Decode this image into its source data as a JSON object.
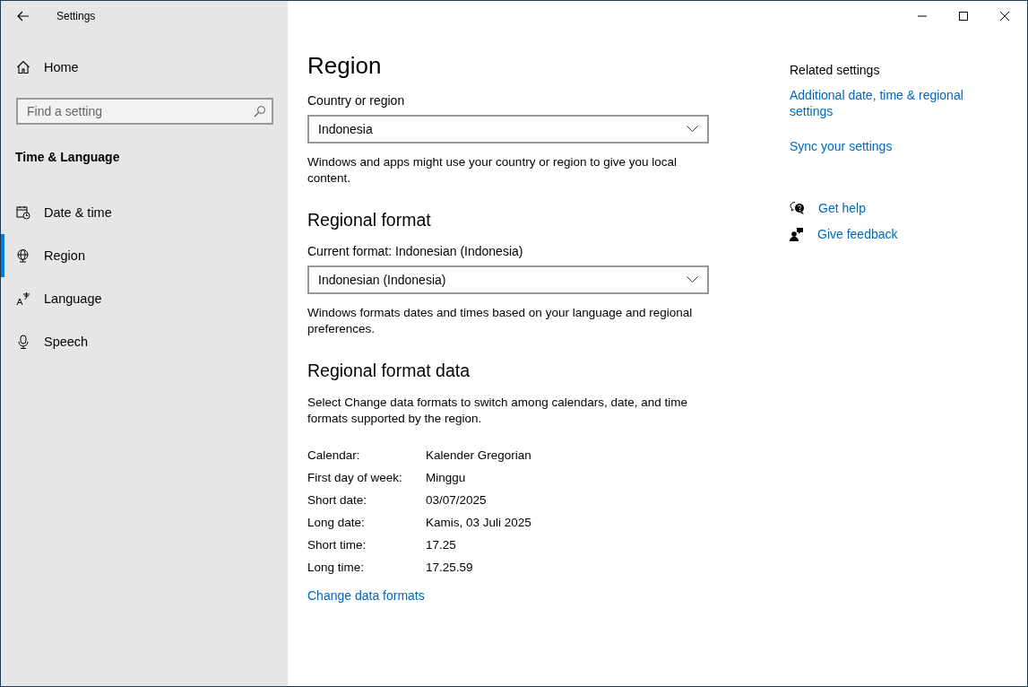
{
  "window": {
    "title": "Settings"
  },
  "sidebar": {
    "home": "Home",
    "search": {
      "placeholder": "Find a setting"
    },
    "section_title": "Time & Language",
    "items": [
      {
        "label": "Date & time",
        "kind": "calendar",
        "selected": false
      },
      {
        "label": "Region",
        "kind": "globe",
        "selected": true
      },
      {
        "label": "Language",
        "kind": "language",
        "selected": false
      },
      {
        "label": "Speech",
        "kind": "microphone",
        "selected": false
      }
    ]
  },
  "main": {
    "title": "Region",
    "country": {
      "label": "Country or region",
      "value": "Indonesia",
      "description": "Windows and apps might use your country or region to give you local content."
    },
    "regional_format": {
      "heading": "Regional format",
      "label": "Current format: Indonesian (Indonesia)",
      "value": "Indonesian (Indonesia)",
      "description": "Windows formats dates and times based on your language and regional preferences."
    },
    "regional_format_data": {
      "heading": "Regional format data",
      "description": "Select Change data formats to switch among calendars, date, and time formats supported by the region.",
      "rows": [
        {
          "label": "Calendar:",
          "value": "Kalender Gregorian"
        },
        {
          "label": "First day of week:",
          "value": "Minggu"
        },
        {
          "label": "Short date:",
          "value": "03/07/2025"
        },
        {
          "label": "Long date:",
          "value": "Kamis, 03 Juli 2025"
        },
        {
          "label": "Short time:",
          "value": "17.25"
        },
        {
          "label": "Long time:",
          "value": "17.25.59"
        }
      ],
      "link": "Change data formats"
    }
  },
  "related": {
    "heading": "Related settings",
    "links": [
      "Additional date, time & regional settings",
      "Sync your settings"
    ],
    "help": [
      {
        "label": "Get help",
        "kind": "help"
      },
      {
        "label": "Give feedback",
        "kind": "feedback"
      }
    ]
  }
}
